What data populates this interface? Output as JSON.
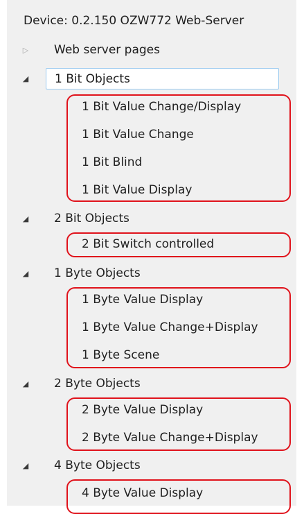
{
  "header": {
    "title": "Device: 0.2.150  OZW772 Web-Server"
  },
  "tree": {
    "web_server": {
      "label": "Web server pages",
      "arrow": "▷"
    },
    "groups": [
      {
        "label": "1 Bit Objects",
        "arrow": "◢",
        "items": [
          "1 Bit Value Change/Display",
          "1 Bit Value Change",
          "1 Bit Blind",
          "1 Bit Value Display"
        ]
      },
      {
        "label": "2 Bit Objects",
        "arrow": "◢",
        "items": [
          "2 Bit Switch controlled"
        ]
      },
      {
        "label": "1 Byte Objects",
        "arrow": "◢",
        "items": [
          "1 Byte Value Display",
          "1 Byte Value Change+Display",
          "1 Byte Scene"
        ]
      },
      {
        "label": "2 Byte Objects",
        "arrow": "◢",
        "items": [
          "2 Byte Value Display",
          "2 Byte Value Change+Display"
        ]
      },
      {
        "label": "4 Byte Objects",
        "arrow": "◢",
        "items": [
          "4 Byte Value Display"
        ]
      }
    ]
  },
  "highlight_color": "#e0121b"
}
